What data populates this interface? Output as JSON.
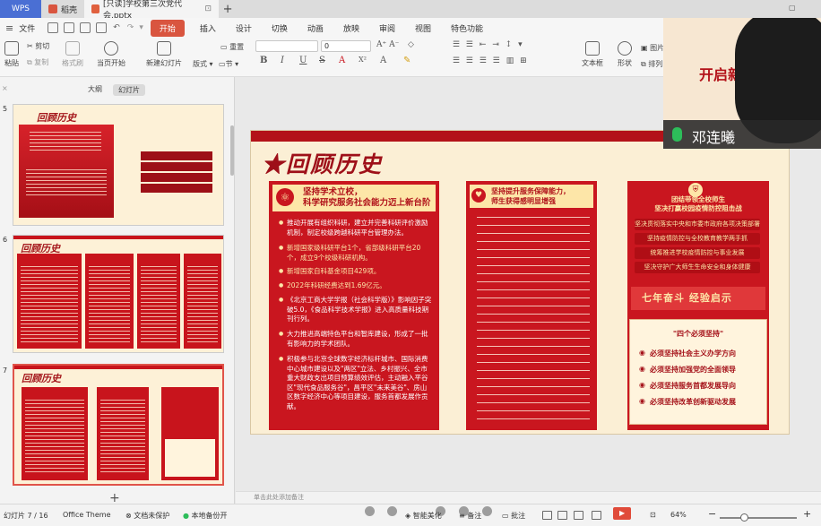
{
  "tabs": {
    "wps": "WPS",
    "home": "稻壳",
    "document": "[只读]学校第三次党代会.pptx"
  },
  "menu": {
    "file": "文件",
    "start": "开始",
    "items": [
      "插入",
      "设计",
      "切换",
      "动画",
      "放映",
      "审阅",
      "视图",
      "特色功能"
    ]
  },
  "ribbon": {
    "cut": "剪切",
    "copy": "复制",
    "format_painter": "格式刷",
    "paste": "粘贴",
    "play_from_current": "当页开始",
    "new_slide": "新建幻灯片",
    "layout": "版式",
    "section": "节",
    "reset": "重置",
    "font_size": "0",
    "textbox": "文本框",
    "shape": "形状",
    "picture": "图片",
    "arrange": "排列"
  },
  "left_panel": {
    "tab_outline": "大纲",
    "tab_slides": "幻灯片",
    "add_label": "+",
    "slides": [
      {
        "number": "5",
        "title": "回顾历史"
      },
      {
        "number": "6",
        "title": "回顾历史"
      },
      {
        "number": "7",
        "title": "回顾历史"
      }
    ]
  },
  "slide": {
    "title": "回顾历史",
    "col1": {
      "heading_1": "坚持学术立校，",
      "heading_2": "科学研究服务社会能力迈上新台阶",
      "bullets": [
        "推动开展有组织科研，建立并完善科研评价激励机制，制定校级跨越科研平台管理办法。",
        "新增国家级科研平台1个，省部级科研平台20个，成立9个校级科研机构。",
        "新增国家自科基金项目429项。",
        "2022年科研经费达到1.69亿元。",
        "《北京工商大学学报（社会科学版）》影响因子突破5.0，《食品科学技术学报》进入高质量科技期刊行列。",
        "大力推进高端特色平台和智库建设，形成了一批有影响力的学术团队。",
        "积极参与北京全球数字经济标杆城市、国际消费中心城市建设以及\"两区\"立法、乡村振兴、全市重大财政支出项目预算绩效评估，主动融入平谷区\"现代食品服务谷\"，昌平区\"未来美谷\"、房山区数字经济中心等项目建设，服务首都发展作贡献。"
      ]
    },
    "col2": {
      "heading_1": "坚持提升服务保障能力，",
      "heading_2": "师生获得感明显增强"
    },
    "col3": {
      "heading_1": "团结带领全校师生",
      "heading_2": "坚决打赢校园疫情防控阻击战",
      "pills": [
        "坚决贯彻落实中央和市委市政府各项决策部署",
        "坚持疫情防控与全校教育教学两手抓",
        "统筹推进学校疫情防控与事业发展",
        "坚决守护广大师生生命安全和身体健康"
      ],
      "banner": "七年奋斗 经验启示",
      "must_title": "\"四个必须坚持\"",
      "musts": [
        "必须坚持社会主义办学方向",
        "必须坚持加强党的全面领导",
        "必须坚持服务首都发展导向",
        "必须坚持改革创新驱动发展"
      ]
    }
  },
  "video": {
    "name": "邓连曦",
    "bg_text": "开启新"
  },
  "notes_placeholder": "单击此处添加备注",
  "status": {
    "slide_counter": "幻灯片 7 / 16",
    "theme": "Office Theme",
    "doc_protect": "文档未保护",
    "backup": "本地备份开",
    "beautify": "智能美化",
    "notes": "备注",
    "comments": "批注",
    "zoom": "64%"
  },
  "colors": {
    "accent": "#c9161f",
    "dark_red": "#9e1019",
    "cream": "#fbefd5",
    "wps_blue": "#4a6fd4"
  }
}
